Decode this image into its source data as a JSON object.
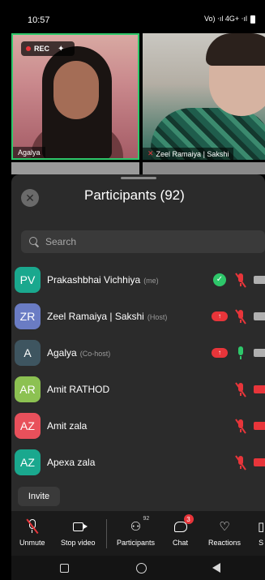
{
  "status_bar": {
    "time": "10:57",
    "indicators": "Vo) ⋅ıl 4G+ ⋅ıl"
  },
  "video_tiles": [
    {
      "name": "Agalya",
      "rec_label": "REC",
      "highlight_color": "#2ec76a"
    },
    {
      "name": "Zeel Ramaiya | Sakshi",
      "muted": true
    }
  ],
  "sheet": {
    "title": "Participants (92)",
    "search_placeholder": "Search",
    "invite_label": "Invite"
  },
  "participants": [
    {
      "initials": "PV",
      "name": "Prakashbhai Vichhiya",
      "role": "(me)",
      "color": "#1aa88e",
      "check": true,
      "cloud": false,
      "mic": "off",
      "camera": "gray"
    },
    {
      "initials": "ZR",
      "name": "Zeel Ramaiya | Sakshi",
      "role": "(Host)",
      "color": "#6a7cc4",
      "check": false,
      "cloud": true,
      "mic": "off",
      "camera": "gray"
    },
    {
      "initials": "A",
      "name": "Agalya",
      "role": "(Co-host)",
      "color": "#3e5560",
      "check": false,
      "cloud": true,
      "mic": "on",
      "camera": "gray"
    },
    {
      "initials": "AR",
      "name": "Amit RATHOD",
      "role": "",
      "color": "#8cc152",
      "check": false,
      "cloud": false,
      "mic": "off",
      "camera": "red"
    },
    {
      "initials": "AZ",
      "name": "Amit zala",
      "role": "",
      "color": "#e8505b",
      "check": false,
      "cloud": false,
      "mic": "off",
      "camera": "red"
    },
    {
      "initials": "AZ",
      "name": "Apexa zala",
      "role": "",
      "color": "#1aa88e",
      "check": false,
      "cloud": false,
      "mic": "off",
      "camera": "red"
    }
  ],
  "toolbar": {
    "unmute": "Unmute",
    "stop_video": "Stop video",
    "participants": "Participants",
    "participants_count": "92",
    "chat": "Chat",
    "chat_badge": "3",
    "reactions": "Reactions",
    "more": "S"
  },
  "colors": {
    "accent_green": "#2ec76a",
    "danger_red": "#e8353a",
    "sheet_bg": "#2b2b2b"
  }
}
